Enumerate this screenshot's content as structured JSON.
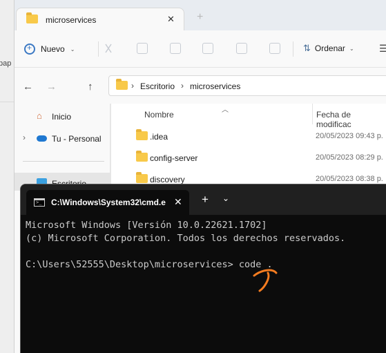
{
  "background": {
    "left_text": "pap"
  },
  "explorer": {
    "tab_title": "microservices",
    "toolbar": {
      "new_label": "Nuevo",
      "sort_label": "Ordenar"
    },
    "breadcrumb": [
      "Escritorio",
      "microservices"
    ],
    "sidebar": [
      {
        "label": "Inicio",
        "icon": "home-icon"
      },
      {
        "label": "Tu - Personal",
        "icon": "cloud-icon"
      },
      {
        "label": "Escritorio",
        "icon": "desktop-icon"
      }
    ],
    "columns": {
      "name": "Nombre",
      "date": "Fecha de modificac"
    },
    "files": [
      {
        "name": ".idea",
        "date": "20/05/2023 09:43 p."
      },
      {
        "name": "config-server",
        "date": "20/05/2023 08:29 p."
      },
      {
        "name": "discovery",
        "date": "20/05/2023 08:38 p."
      }
    ]
  },
  "terminal": {
    "tab_title": "C:\\Windows\\System32\\cmd.e",
    "lines": [
      "Microsoft Windows [Versión 10.0.22621.1702]",
      "(c) Microsoft Corporation. Todos los derechos reservados.",
      "",
      "C:\\Users\\52555\\Desktop\\microservices> code ."
    ],
    "annotation_color": "#f57c20"
  }
}
